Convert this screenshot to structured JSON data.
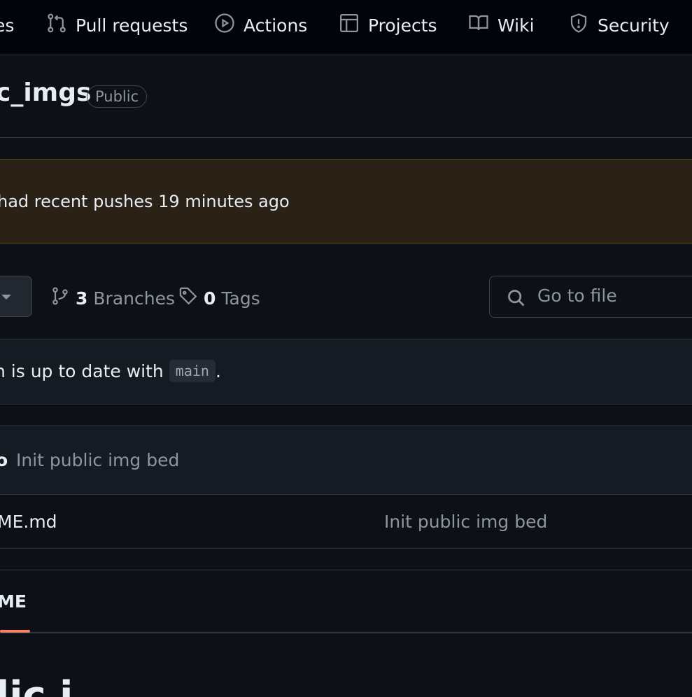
{
  "nav": {
    "items": [
      {
        "label": "es",
        "icon": "none"
      },
      {
        "label": "Pull requests",
        "icon": "git-pull-request-icon"
      },
      {
        "label": "Actions",
        "icon": "play-icon"
      },
      {
        "label": "Projects",
        "icon": "table-icon"
      },
      {
        "label": "Wiki",
        "icon": "book-icon"
      },
      {
        "label": "Security",
        "icon": "shield-icon"
      }
    ]
  },
  "repo": {
    "name": "c_imgs",
    "visibility": "Public"
  },
  "push_banner": {
    "text": "had recent pushes 19 minutes ago"
  },
  "refs": {
    "branches_count": "3",
    "branches_label": "Branches",
    "tags_count": "0",
    "tags_label": "Tags"
  },
  "search": {
    "placeholder": "Go to file"
  },
  "status": {
    "text": "h is up to date with",
    "branch": "main",
    "suffix": "."
  },
  "latest_commit": {
    "author": "o",
    "message": "Init public img bed"
  },
  "files": [
    {
      "name": "ME.md",
      "commit": "Init public img bed"
    }
  ],
  "readme": {
    "tab_label": "ME",
    "heading_fragment": "lic i"
  },
  "colors": {
    "background": "#0d1117",
    "nav_background": "#010409",
    "banner_background": "#2a2217",
    "tab_accent": "#f78166",
    "muted_text": "#8d96a0"
  }
}
